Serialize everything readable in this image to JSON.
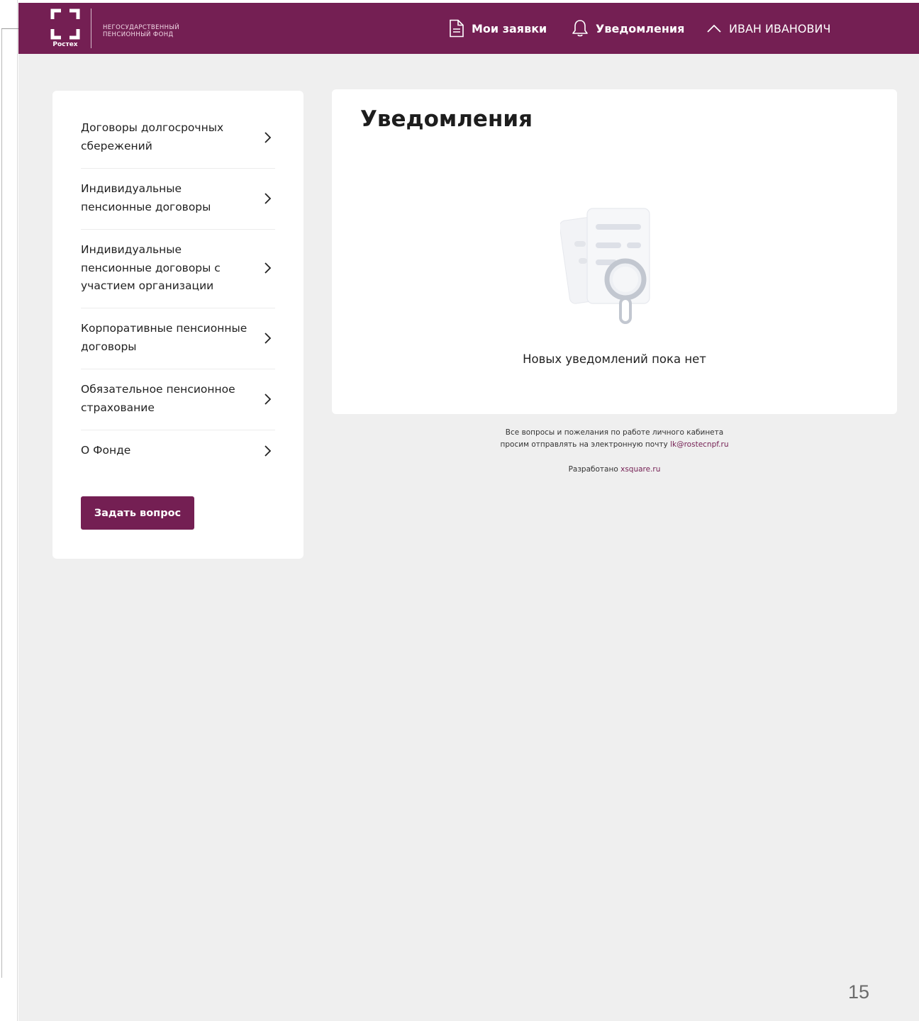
{
  "header": {
    "logo_caption": "Ростех",
    "logo_text_line1": "НЕГОСУДАРСТВЕННЫЙ",
    "logo_text_line2": "ПЕНСИОННЫЙ ФОНД",
    "nav": {
      "requests": "Мои заявки",
      "notifications": "Уведомления",
      "user": "ИВАН ИВАНОВИЧ"
    },
    "icons": [
      "document-icon",
      "bell-icon",
      "chevron-up-icon"
    ],
    "background_color": "#741f53"
  },
  "sidebar": {
    "items": [
      {
        "label": "Договоры долгосрочных сбережений"
      },
      {
        "label": "Индивидуальные пенсионные договоры"
      },
      {
        "label": "Индивидуальные пенсионные договоры с участием организации"
      },
      {
        "label": "Корпоративные пенсионные договоры"
      },
      {
        "label": "Обязательное пенсионное страхование"
      },
      {
        "label": "О Фонде"
      }
    ],
    "ask_button": "Задать вопрос"
  },
  "main": {
    "title": "Уведомления",
    "empty_message": "Новых уведомлений пока нет",
    "empty_icon": "document-search-icon"
  },
  "footer": {
    "line1": "Все вопросы и пожелания по работе личного кабинета",
    "line2_prefix": "просим отправлять на электронную почту ",
    "email": "lk@rostecnpf.ru",
    "dev_prefix": "Разработано ",
    "dev_link": "xsquare.ru"
  },
  "slide": {
    "page_number": "15"
  }
}
